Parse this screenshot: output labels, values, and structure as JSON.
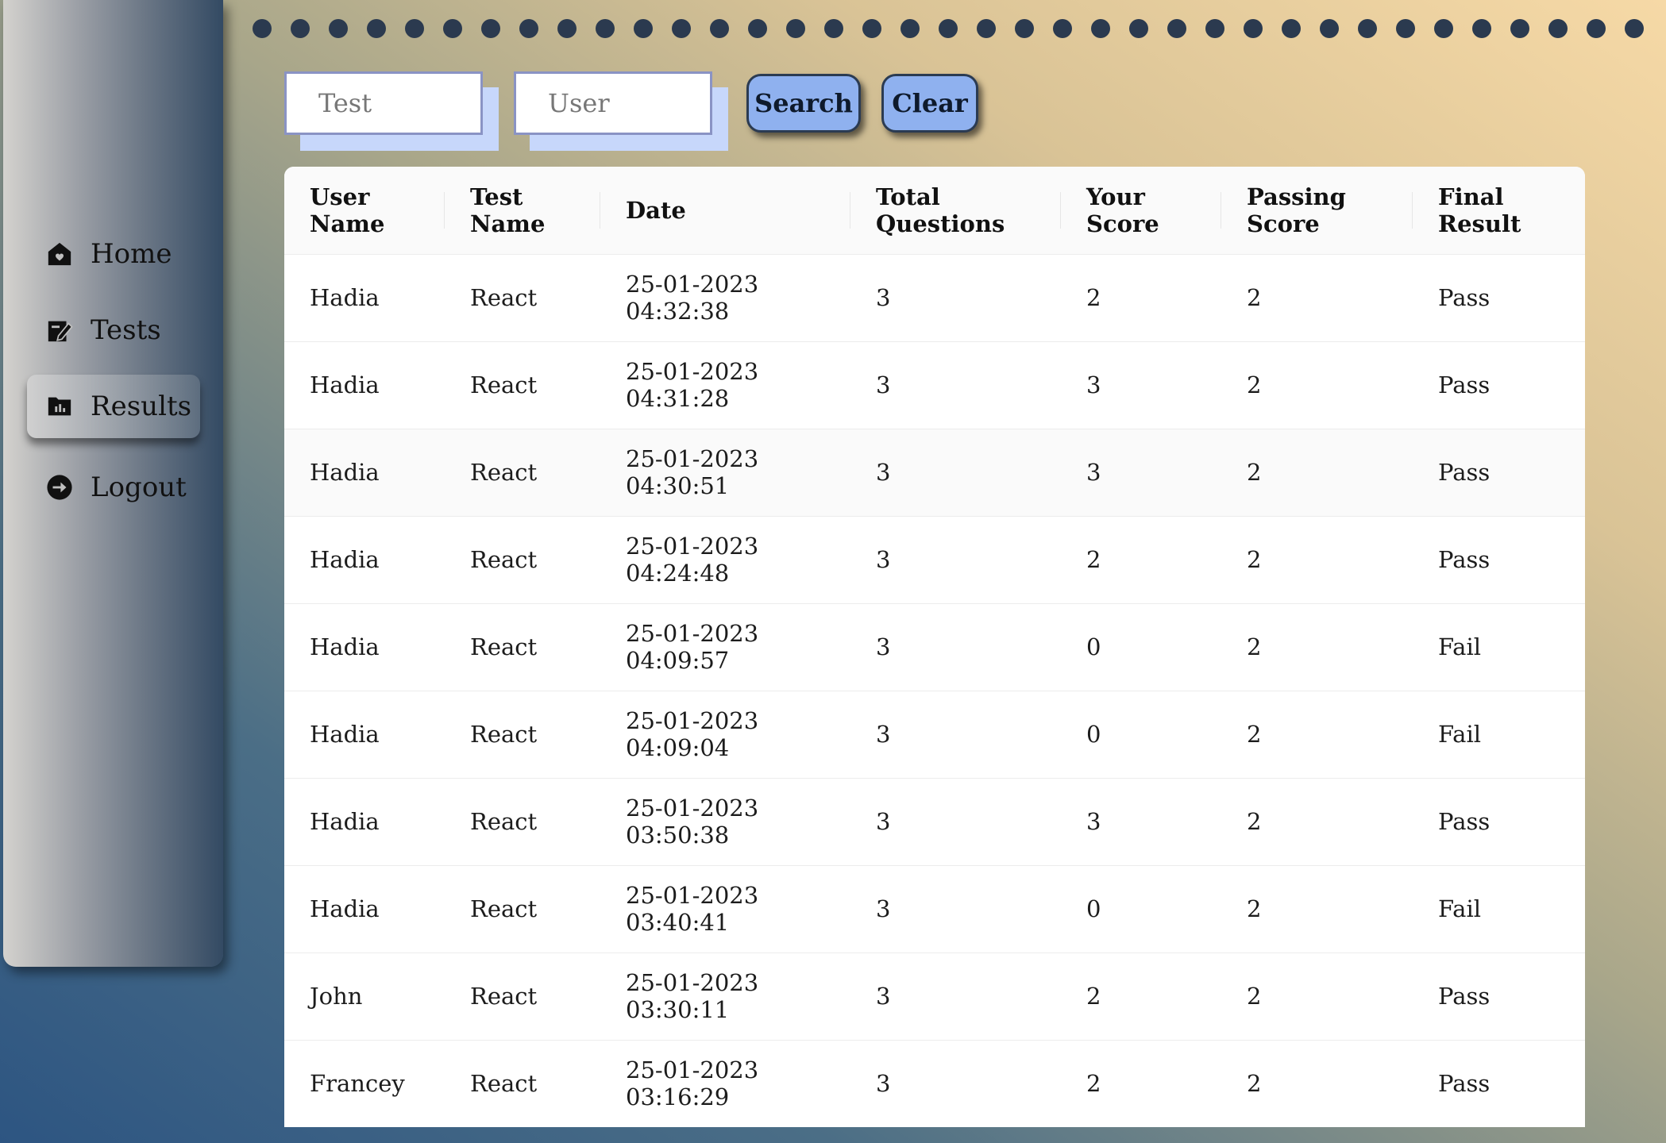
{
  "sidebar": {
    "items": [
      {
        "label": "Home",
        "icon": "home-icon"
      },
      {
        "label": "Tests",
        "icon": "edit-note-icon"
      },
      {
        "label": "Results",
        "icon": "chart-folder-icon"
      },
      {
        "label": "Logout",
        "icon": "logout-icon"
      }
    ],
    "active": "Results"
  },
  "search": {
    "test_placeholder": "Test",
    "user_placeholder": "User",
    "search_label": "Search",
    "clear_label": "Clear"
  },
  "table": {
    "headers": [
      "User Name",
      "Test Name",
      "Date",
      "Total Questions",
      "Your Score",
      "Passing Score",
      "Final Result"
    ],
    "rows": [
      [
        "Hadia",
        "React",
        "25-01-2023 04:32:38",
        "3",
        "2",
        "2",
        "Pass"
      ],
      [
        "Hadia",
        "React",
        "25-01-2023 04:31:28",
        "3",
        "3",
        "2",
        "Pass"
      ],
      [
        "Hadia",
        "React",
        "25-01-2023 04:30:51",
        "3",
        "3",
        "2",
        "Pass"
      ],
      [
        "Hadia",
        "React",
        "25-01-2023 04:24:48",
        "3",
        "2",
        "2",
        "Pass"
      ],
      [
        "Hadia",
        "React",
        "25-01-2023 04:09:57",
        "3",
        "0",
        "2",
        "Fail"
      ],
      [
        "Hadia",
        "React",
        "25-01-2023 04:09:04",
        "3",
        "0",
        "2",
        "Fail"
      ],
      [
        "Hadia",
        "React",
        "25-01-2023 03:50:38",
        "3",
        "3",
        "2",
        "Pass"
      ],
      [
        "Hadia",
        "React",
        "25-01-2023 03:40:41",
        "3",
        "0",
        "2",
        "Fail"
      ],
      [
        "John",
        "React",
        "25-01-2023 03:30:11",
        "3",
        "2",
        "2",
        "Pass"
      ],
      [
        "Francey",
        "React",
        "25-01-2023 03:16:29",
        "3",
        "2",
        "2",
        "Pass"
      ]
    ]
  },
  "colors": {
    "button_fill": "#8fb1ef",
    "input_shadow": "#c7d7fb",
    "dot": "#2b3a4f"
  }
}
